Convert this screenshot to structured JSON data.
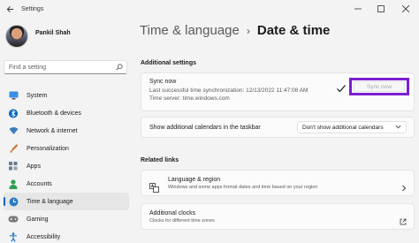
{
  "window": {
    "title": "Settings",
    "back_icon": "back-arrow-icon",
    "controls": [
      "minimize-icon",
      "maximize-icon",
      "close-icon"
    ]
  },
  "profile": {
    "name": "Pankil Shah"
  },
  "search": {
    "placeholder": "Find a setting"
  },
  "sidebar": {
    "items": [
      {
        "label": "System",
        "icon": "monitor-icon",
        "color": "#0067c0"
      },
      {
        "label": "Bluetooth & devices",
        "icon": "bluetooth-icon",
        "color": "#0067c0"
      },
      {
        "label": "Network & internet",
        "icon": "wifi-icon",
        "color": "#3c7dbf"
      },
      {
        "label": "Personalization",
        "icon": "brush-icon",
        "color": "#c96b2a"
      },
      {
        "label": "Apps",
        "icon": "apps-icon",
        "color": "#5a6b7b"
      },
      {
        "label": "Accounts",
        "icon": "person-icon",
        "color": "#2e9f4e"
      },
      {
        "label": "Time & language",
        "icon": "globe-clock-icon",
        "color": "#2b7bc2",
        "active": true
      },
      {
        "label": "Gaming",
        "icon": "controller-icon",
        "color": "#6b6b6b"
      },
      {
        "label": "Accessibility",
        "icon": "accessibility-icon",
        "color": "#2b7bc2"
      }
    ]
  },
  "breadcrumb": {
    "parent": "Time & language",
    "separator": "›",
    "current": "Date & time"
  },
  "additional_settings": {
    "heading": "Additional settings",
    "sync": {
      "title": "Sync now",
      "last_sync": "Last successful time synchronization: 12/13/2022 11:47:08 AM",
      "time_server": "Time server: time.windows.com",
      "button_label": "Sync now",
      "highlight_color": "#7b1fd1"
    },
    "calendars": {
      "label": "Show additional calendars in the taskbar",
      "selected": "Don't show additional calendars"
    }
  },
  "related_links": {
    "heading": "Related links",
    "language_region": {
      "title": "Language & region",
      "description": "Windows and some apps format dates and time based on your region"
    },
    "additional_clocks": {
      "title": "Additional clocks",
      "description": "Clocks for different time zones"
    }
  },
  "colors": {
    "accent": "#0067c0",
    "background": "#f3f3f3",
    "card": "#fbfbfb"
  }
}
